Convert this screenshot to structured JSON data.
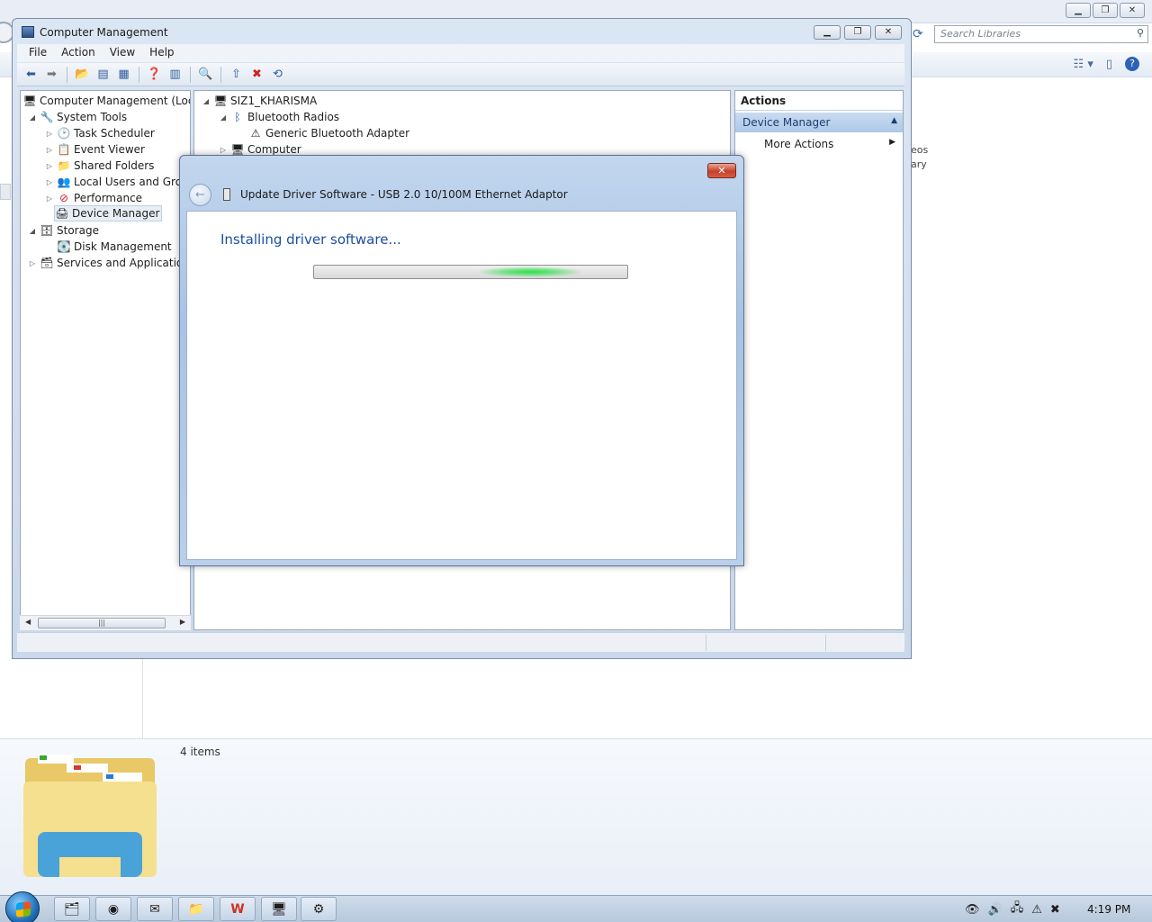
{
  "background_window": {
    "search_placeholder": "Search Libraries",
    "side_text_1": "eos",
    "side_text_2": "ary",
    "items_count": "4 items"
  },
  "cm_window": {
    "title": "Computer Management",
    "menu": [
      "File",
      "Action",
      "View",
      "Help"
    ],
    "left_tree": [
      {
        "label": "Computer Management (Local",
        "icon": "computer-management-icon",
        "level": 0,
        "expander": ""
      },
      {
        "label": "System Tools",
        "icon": "tools-icon",
        "level": 1,
        "expander": "◢"
      },
      {
        "label": "Task Scheduler",
        "icon": "clock-icon",
        "level": 2,
        "expander": "▷"
      },
      {
        "label": "Event Viewer",
        "icon": "event-viewer-icon",
        "level": 2,
        "expander": "▷"
      },
      {
        "label": "Shared Folders",
        "icon": "shared-folders-icon",
        "level": 2,
        "expander": "▷"
      },
      {
        "label": "Local Users and Group",
        "icon": "users-icon",
        "level": 2,
        "expander": "▷"
      },
      {
        "label": "Performance",
        "icon": "performance-icon",
        "level": 2,
        "expander": "▷"
      },
      {
        "label": "Device Manager",
        "icon": "device-manager-icon",
        "level": 2,
        "expander": "",
        "selected": true
      },
      {
        "label": "Storage",
        "icon": "storage-icon",
        "level": 1,
        "expander": "◢"
      },
      {
        "label": "Disk Management",
        "icon": "disk-icon",
        "level": 2,
        "expander": ""
      },
      {
        "label": "Services and Applications",
        "icon": "services-icon",
        "level": 1,
        "expander": "▷"
      }
    ],
    "device_tree": [
      {
        "label": "SIZ1_KHARISMA",
        "icon": "computer-icon"
      },
      {
        "label": "Bluetooth Radios",
        "icon": "bluetooth-icon"
      },
      {
        "label": "Generic Bluetooth Adapter",
        "icon": "bluetooth-warning-icon"
      },
      {
        "label": "Computer",
        "icon": "computer-icon"
      }
    ],
    "actions": {
      "header": "Actions",
      "section": "Device Manager",
      "more": "More Actions"
    }
  },
  "dialog": {
    "heading": "Update Driver Software - USB 2.0 10/100M Ethernet Adaptor",
    "status": "Installing driver software...",
    "close_label": "✕"
  },
  "taskbar": {
    "clock": "4:19 PM"
  }
}
